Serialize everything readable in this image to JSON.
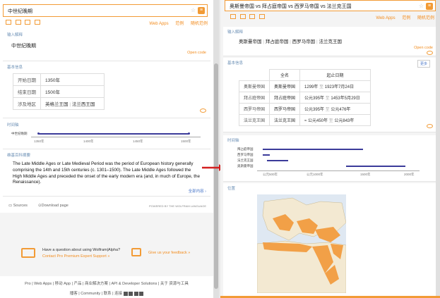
{
  "left": {
    "search_value": "中世纪晚期",
    "toolbar": {
      "web_apps": "Web Apps",
      "examples": "范例",
      "random": "随机范例"
    },
    "input_interp": {
      "title": "输入解释",
      "value": "中世纪晚期",
      "open_code": "Open code"
    },
    "basic_info": {
      "title": "基本信息",
      "rows": [
        {
          "label": "开始日期",
          "value": "1350年"
        },
        {
          "label": "结束日期",
          "value": "1500年"
        },
        {
          "label": "涉及地区",
          "values": [
            "英格兰王国",
            "法兰西王国"
          ]
        }
      ]
    },
    "timeline": {
      "title": "时间轴",
      "row_label": "中世纪晚期",
      "ticks": [
        "1350年",
        "1400年",
        "1450年",
        "1500年"
      ]
    },
    "wiki": {
      "title": "维基百科摘要",
      "text": "The Late Middle Ages or Late Medieval Period was the period of European history generally comprising the 14th and 15th centuries (c. 1301–1500). The Late Middle Ages followed the High Middle Ages and preceded the onset of the early modern era (and, in much of Europe, the Renaissance).",
      "more": "全部内容 ›"
    },
    "bottom": {
      "sources": "Sources",
      "download": "Download page",
      "powered": "POWERED BY THE WOLFRAM LANGUAGE"
    },
    "contact": {
      "question": "Have a question about using Wolfram|Alpha?",
      "contact_link": "Contact Pro Premium Expert Support »",
      "feedback": "Give us your feedback »"
    },
    "footer_links": [
      "Pro",
      "Web Apps",
      "移动 App",
      "产品",
      "商业解决方案",
      "API & Developer Solutions",
      "关于 资源与工具"
    ],
    "footer_links2": [
      "播客",
      "Community",
      "联系",
      "连接"
    ]
  },
  "right": {
    "search_value": "奥斯曼帝国 vs 拜占庭帝国 vs 西罗马帝国 vs 法兰克王国",
    "toolbar": {
      "web_apps": "Web Apps",
      "examples": "范例",
      "random": "随机范例"
    },
    "input_interp": {
      "title": "输入解释",
      "values": [
        "奥斯曼帝国",
        "拜占庭帝国",
        "西罗马帝国",
        "法兰克王国"
      ],
      "open_code": "Open code"
    },
    "basic_info": {
      "title": "基本信息",
      "more": "更多",
      "headers": [
        "全名",
        "起止日期"
      ],
      "rows": [
        {
          "label": "奥斯曼帝国",
          "full": "奥斯曼帝国",
          "from": "1299年",
          "to": "1923年7月24日"
        },
        {
          "label": "拜占庭帝国",
          "full": "拜占庭帝国",
          "from": "公元395年",
          "to": "1453年5月29日"
        },
        {
          "label": "西罗马帝国",
          "full": "西罗马帝国",
          "from": "公元395年",
          "to": "公元476年"
        },
        {
          "label": "法兰克王国",
          "full": "法兰克王国",
          "from": "≈ 公元450年",
          "to": "公元843年"
        }
      ],
      "sep": "至"
    },
    "timeline": {
      "title": "时间轴",
      "labels": [
        "拜占庭帝国",
        "西罗马帝国",
        "法兰克王国",
        "奥斯曼帝国"
      ],
      "ticks": [
        "公元500年",
        "公元1000年",
        "1500年",
        "2000年"
      ]
    },
    "location": {
      "title": "位置"
    }
  }
}
